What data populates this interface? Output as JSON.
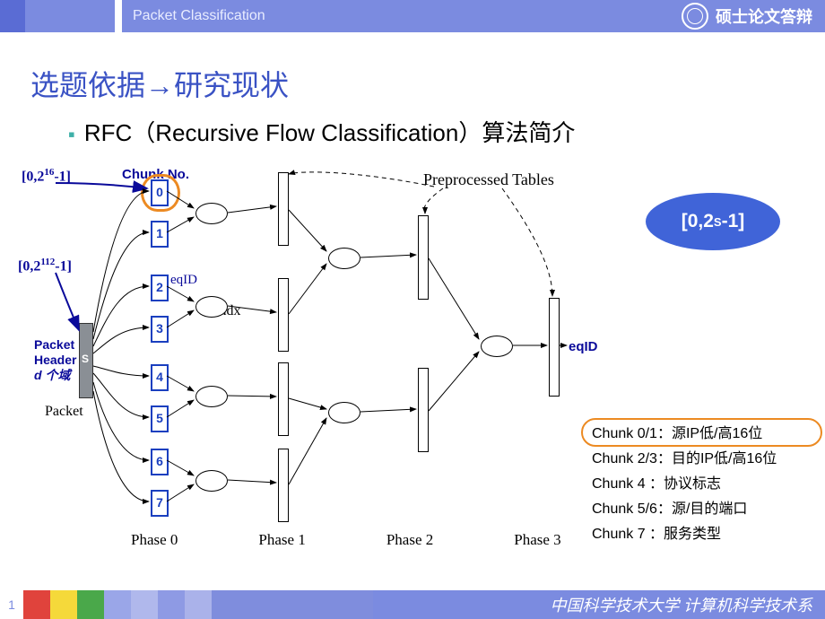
{
  "topbar": {
    "title": "Packet Classification",
    "right": "硕士论文答辩"
  },
  "heading": "选题依据→研究现状",
  "bullet": "RFC（Recursive Flow Classification）算法简介",
  "labels": {
    "range16": "[0,2",
    "range16_exp": "16",
    "range16_tail": "-1]",
    "range112": "[0,2",
    "range112_exp": "112",
    "range112_tail": "-1]",
    "chunk_no": "Chunk No.",
    "packet_header_l1": "Packet",
    "packet_header_l2": "Header",
    "packet_header_l3": "d 个域",
    "packet": "Packet",
    "packet_bar": "S",
    "eqid": "eqID",
    "indx": "indx",
    "eqid_out": "eqID",
    "preprocessed": "Preprocessed Tables",
    "phases": [
      "Phase 0",
      "Phase 1",
      "Phase 2",
      "Phase 3"
    ]
  },
  "chunks": [
    "0",
    "1",
    "2",
    "3",
    "4",
    "5",
    "6",
    "7"
  ],
  "badge": {
    "a": "[0,2",
    "exp": "S",
    "b": "-1]"
  },
  "legend": [
    "Chunk  0/1：源IP低/高16位",
    "Chunk  2/3：目的IP低/高16位",
    "Chunk   4  ：协议标志",
    "Chunk  5/6：源/目的端口",
    "Chunk   7  ：服务类型"
  ],
  "bottombar": {
    "page": "1",
    "right": "中国科学技术大学 计算机科学技术系"
  }
}
